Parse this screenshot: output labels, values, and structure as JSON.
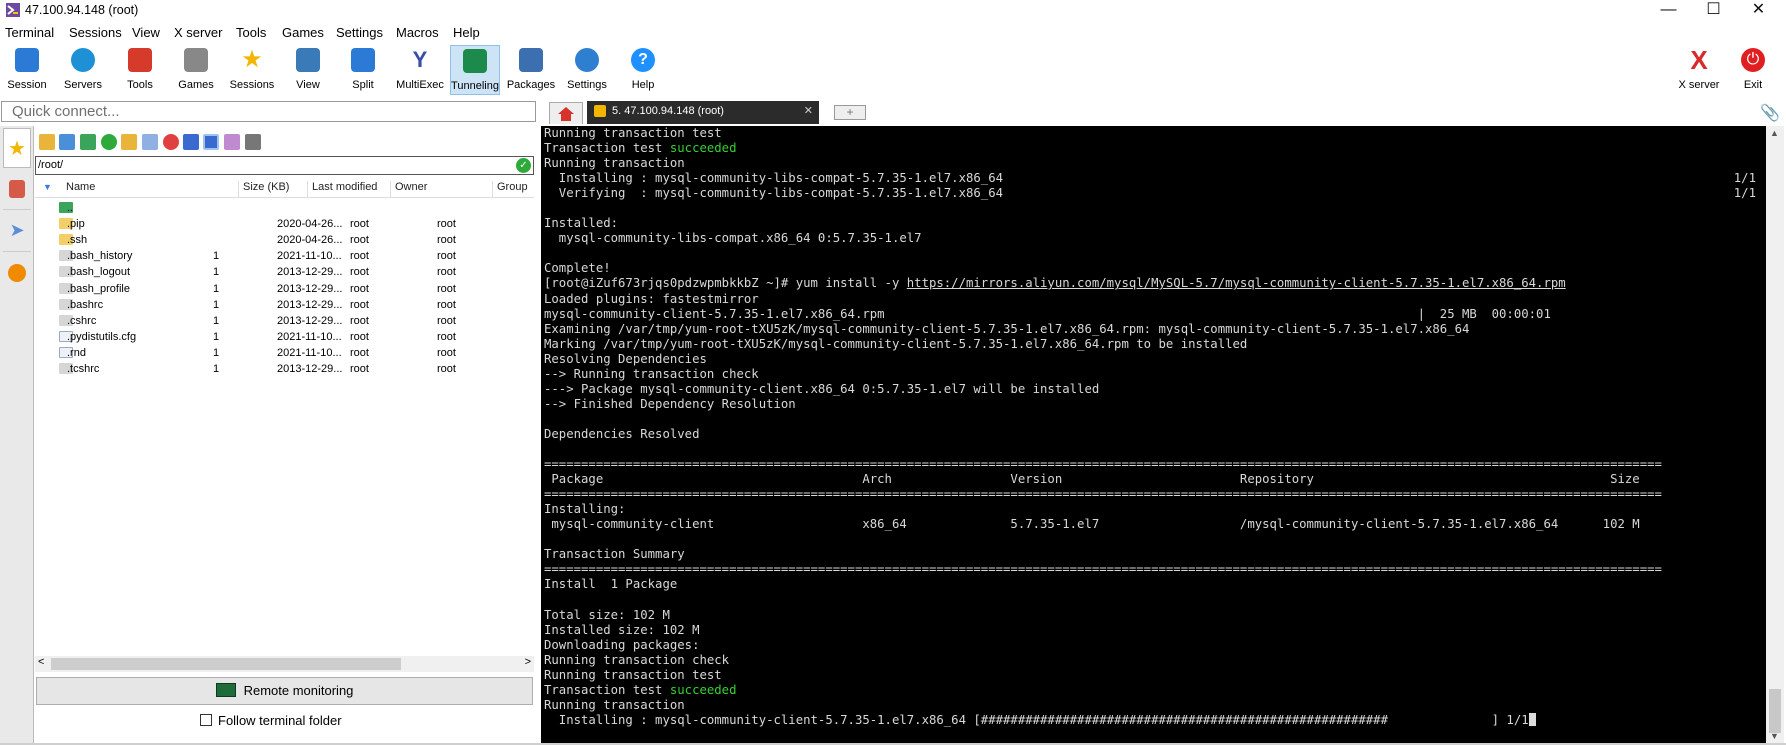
{
  "window": {
    "title": "47.100.94.148 (root)"
  },
  "menu": [
    "Terminal",
    "Sessions",
    "View",
    "X server",
    "Tools",
    "Games",
    "Settings",
    "Macros",
    "Help"
  ],
  "toolbar": {
    "left": [
      {
        "label": "Session",
        "icon": "session-icon",
        "color": "#2b7bd6"
      },
      {
        "label": "Servers",
        "icon": "servers-icon",
        "color": "#1e90d6"
      },
      {
        "label": "Tools",
        "icon": "tools-icon",
        "color": "#d63a2b"
      },
      {
        "label": "Games",
        "icon": "games-icon",
        "color": "#888888"
      },
      {
        "label": "Sessions",
        "icon": "star-icon",
        "color": "#f2b600"
      },
      {
        "label": "View",
        "icon": "view-icon",
        "color": "#3a7ab8"
      },
      {
        "label": "Split",
        "icon": "split-icon",
        "color": "#2b7bd6"
      },
      {
        "label": "MultiExec",
        "icon": "multiexec-icon",
        "color": "#3a4ea8"
      },
      {
        "label": "Tunneling",
        "icon": "tunneling-icon",
        "color": "#1b8a4a"
      },
      {
        "label": "Packages",
        "icon": "packages-icon",
        "color": "#3b6fb0"
      },
      {
        "label": "Settings",
        "icon": "settings-icon",
        "color": "#2f7fd0"
      },
      {
        "label": "Help",
        "icon": "help-icon",
        "color": "#1e90ff"
      }
    ],
    "right": [
      {
        "label": "X server",
        "icon": "x-server-icon",
        "color": "#d62b2b"
      },
      {
        "label": "Exit",
        "icon": "power-icon",
        "color": "#e02020"
      }
    ]
  },
  "quick_connect": {
    "placeholder": "Quick connect..."
  },
  "tabs": {
    "session_tab": "5. 47.100.94.148 (root)"
  },
  "file_panel": {
    "path": "/root/",
    "columns": [
      "Name",
      "Size (KB)",
      "Last modified",
      "Owner",
      "Group"
    ],
    "rows": [
      {
        "name": "..",
        "size": "",
        "modified": "",
        "owner": "",
        "group": "",
        "kind": "up"
      },
      {
        "name": ".pip",
        "size": "",
        "modified": "2020-04-26...",
        "owner": "root",
        "group": "root",
        "kind": "folder"
      },
      {
        "name": ".ssh",
        "size": "",
        "modified": "2020-04-26...",
        "owner": "root",
        "group": "root",
        "kind": "folder"
      },
      {
        "name": ".bash_history",
        "size": "1",
        "modified": "2021-11-10...",
        "owner": "root",
        "group": "root",
        "kind": "file"
      },
      {
        "name": ".bash_logout",
        "size": "1",
        "modified": "2013-12-29...",
        "owner": "root",
        "group": "root",
        "kind": "file"
      },
      {
        "name": ".bash_profile",
        "size": "1",
        "modified": "2013-12-29...",
        "owner": "root",
        "group": "root",
        "kind": "file"
      },
      {
        "name": ".bashrc",
        "size": "1",
        "modified": "2013-12-29...",
        "owner": "root",
        "group": "root",
        "kind": "file"
      },
      {
        "name": ".cshrc",
        "size": "1",
        "modified": "2013-12-29...",
        "owner": "root",
        "group": "root",
        "kind": "file"
      },
      {
        "name": ".pydistutils.cfg",
        "size": "1",
        "modified": "2021-11-10...",
        "owner": "root",
        "group": "root",
        "kind": "doc"
      },
      {
        "name": ".rnd",
        "size": "1",
        "modified": "2021-11-10...",
        "owner": "root",
        "group": "root",
        "kind": "doc"
      },
      {
        "name": ".tcshrc",
        "size": "1",
        "modified": "2013-12-29...",
        "owner": "root",
        "group": "root",
        "kind": "file"
      }
    ],
    "remote_monitoring": "Remote monitoring",
    "follow_terminal": "Follow terminal folder"
  },
  "terminal": {
    "lines": [
      {
        "t": "Running transaction test"
      },
      {
        "t": "Transaction test ",
        "g": "succeeded"
      },
      {
        "t": "Running transaction"
      },
      {
        "t": "  Installing : mysql-community-libs-compat-5.7.35-1.el7.x86_64",
        "r": "1/1"
      },
      {
        "t": "  Verifying  : mysql-community-libs-compat-5.7.35-1.el7.x86_64",
        "r": "1/1"
      },
      {
        "t": ""
      },
      {
        "t": "Installed:"
      },
      {
        "t": "  mysql-community-libs-compat.x86_64 0:5.7.35-1.el7"
      },
      {
        "t": ""
      },
      {
        "t": "Complete!"
      },
      {
        "t": "[root@iZuf673rjqs0pdzwpmbkkbZ ~]# yum install -y ",
        "u": "https://mirrors.aliyun.com/mysql/MySQL-5.7/mysql-community-client-5.7.35-1.el7.x86_64.rpm"
      },
      {
        "t": "Loaded plugins: fastestmirror"
      },
      {
        "t": "mysql-community-client-5.7.35-1.el7.x86_64.rpm                                                                        |  25 MB  00:00:01"
      },
      {
        "t": "Examining /var/tmp/yum-root-tXU5zK/mysql-community-client-5.7.35-1.el7.x86_64.rpm: mysql-community-client-5.7.35-1.el7.x86_64"
      },
      {
        "t": "Marking /var/tmp/yum-root-tXU5zK/mysql-community-client-5.7.35-1.el7.x86_64.rpm to be installed"
      },
      {
        "t": "Resolving Dependencies"
      },
      {
        "t": "--> Running transaction check"
      },
      {
        "t": "---> Package mysql-community-client.x86_64 0:5.7.35-1.el7 will be installed"
      },
      {
        "t": "--> Finished Dependency Resolution"
      },
      {
        "t": ""
      },
      {
        "t": "Dependencies Resolved"
      },
      {
        "t": ""
      },
      {
        "t": "======================================================================================================================================================="
      },
      {
        "t": " Package                                   Arch                Version                        Repository                                        Size"
      },
      {
        "t": "======================================================================================================================================================="
      },
      {
        "t": "Installing:"
      },
      {
        "t": " mysql-community-client                    x86_64              5.7.35-1.el7                   /mysql-community-client-5.7.35-1.el7.x86_64      102 M"
      },
      {
        "t": ""
      },
      {
        "t": "Transaction Summary"
      },
      {
        "t": "======================================================================================================================================================="
      },
      {
        "t": "Install  1 Package"
      },
      {
        "t": ""
      },
      {
        "t": "Total size: 102 M"
      },
      {
        "t": "Installed size: 102 M"
      },
      {
        "t": "Downloading packages:"
      },
      {
        "t": "Running transaction check"
      },
      {
        "t": "Running transaction test"
      },
      {
        "t": "Transaction test ",
        "g": "succeeded"
      },
      {
        "t": "Running transaction"
      },
      {
        "t": "  Installing : mysql-community-client-5.7.35-1.el7.x86_64 [#######################################################              ] 1/1",
        "cursor": true
      }
    ]
  }
}
